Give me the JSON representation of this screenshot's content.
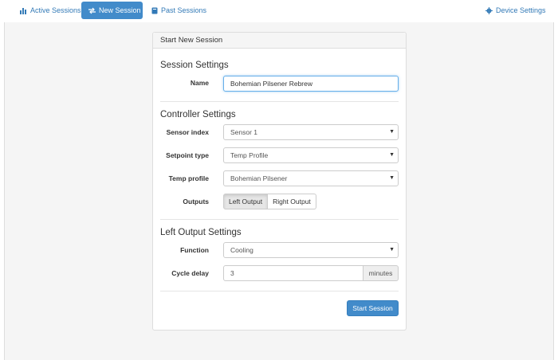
{
  "nav": {
    "active_sessions": "Active Sessions",
    "new_session": "New Session",
    "past_sessions": "Past Sessions",
    "device_settings": "Device Settings"
  },
  "panel": {
    "title": "Start New Session"
  },
  "session_settings": {
    "heading": "Session Settings",
    "name_label": "Name",
    "name_value": "Bohemian Pilsener Rebrew"
  },
  "controller_settings": {
    "heading": "Controller Settings",
    "sensor_label": "Sensor index",
    "sensor_value": "Sensor 1",
    "setpoint_label": "Setpoint type",
    "setpoint_value": "Temp Profile",
    "profile_label": "Temp profile",
    "profile_value": "Bohemian Pilsener",
    "outputs_label": "Outputs",
    "left_output": "Left Output",
    "right_output": "Right Output",
    "selected_output": "Left Output"
  },
  "left_output_settings": {
    "heading": "Left Output Settings",
    "function_label": "Function",
    "function_value": "Cooling",
    "cycle_label": "Cycle delay",
    "cycle_value": "3",
    "cycle_unit": "minutes"
  },
  "actions": {
    "start": "Start Session"
  },
  "icons": {
    "active_sessions": "bar-chart-icon",
    "new_session": "exchange-icon",
    "past_sessions": "book-icon",
    "device_settings": "gear-icon"
  },
  "colors": {
    "accent": "#428bca",
    "link": "#337ab7"
  }
}
